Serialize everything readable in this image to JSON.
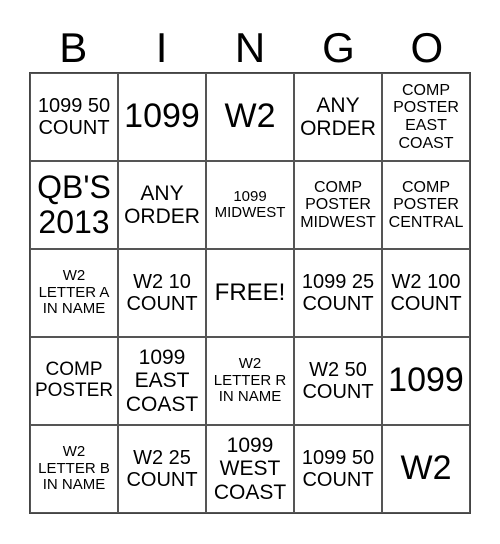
{
  "header": [
    "B",
    "I",
    "N",
    "G",
    "O"
  ],
  "cells": [
    "1099 50 COUNT",
    "1099",
    "W2",
    "ANY ORDER",
    "COMP POSTER EAST COAST",
    "QB'S 2013",
    "ANY ORDER",
    "1099 MIDWEST",
    "COMP POSTER MIDWEST",
    "COMP POSTER CENTRAL",
    "W2 LETTER A IN NAME",
    "W2 10 COUNT",
    "FREE!",
    "1099 25 COUNT",
    "W2 100 COUNT",
    "COMP POSTER",
    "1099 EAST COAST",
    "W2 LETTER R IN NAME",
    "W2 50 COUNT",
    "1099",
    "W2 LETTER B IN NAME",
    "W2 25 COUNT",
    "1099 WEST COAST",
    "1099 50 COUNT",
    "W2"
  ]
}
